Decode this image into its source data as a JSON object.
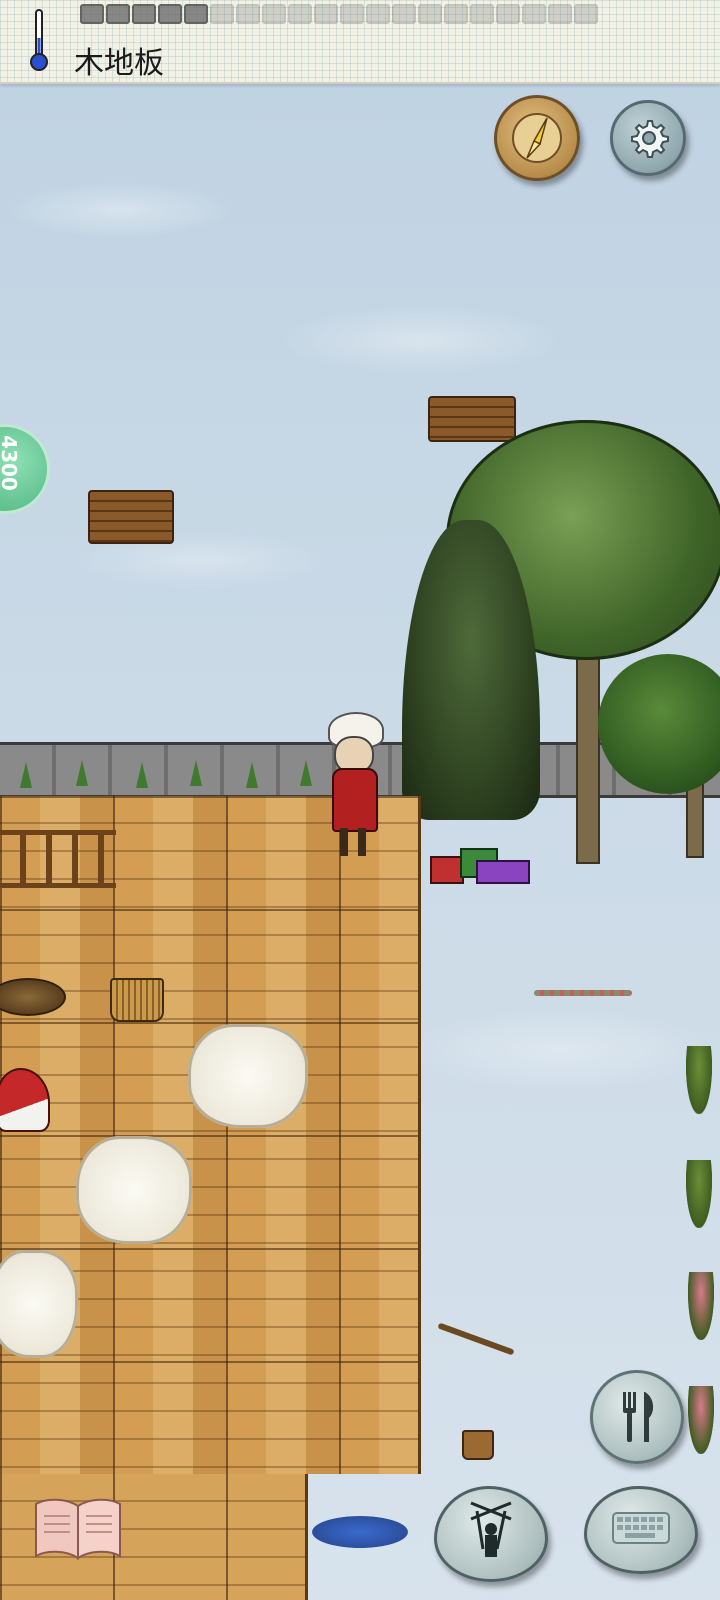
{
  "hud": {
    "temperature_label": "木地板",
    "side_tab_value": "4300"
  },
  "icons": {
    "thermometer": "thermometer-icon",
    "compass": "compass-icon",
    "settings": "gear-icon",
    "eat": "fork-knife-icon",
    "emote": "puppet-icon",
    "keyboard": "keyboard-icon",
    "book": "open-book-icon"
  },
  "colors": {
    "snow": "#c9d9e6",
    "floor": "#d6a35a",
    "accent_green": "#5fc08e",
    "compass_brass": "#b88d4b"
  }
}
